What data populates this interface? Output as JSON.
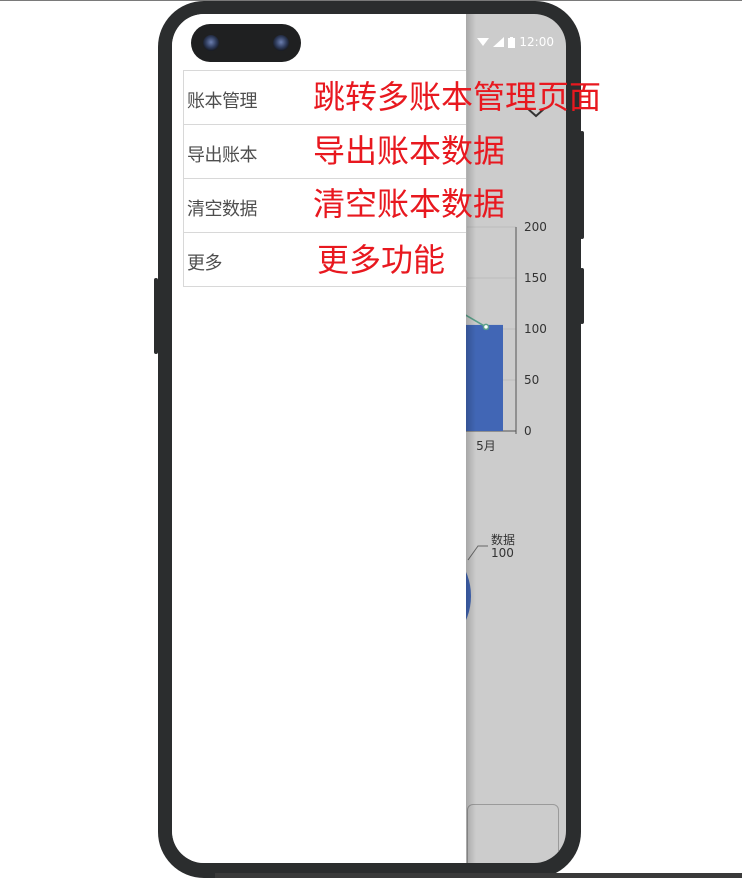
{
  "status_bar": {
    "time": "12:00"
  },
  "menu": {
    "items": [
      {
        "label": "账本管理"
      },
      {
        "label": "导出账本"
      },
      {
        "label": "清空数据"
      },
      {
        "label": "更多"
      }
    ]
  },
  "annotations": [
    "跳转多账本管理页面",
    "导出账本数据",
    "清空账本数据",
    "更多功能"
  ],
  "colors": {
    "annotation": "#e8181f",
    "bar": "#4166b5",
    "line": "#5aa08a",
    "overlay": "#cccccc"
  },
  "chart_data": [
    {
      "type": "bar",
      "categories": [
        "5月"
      ],
      "values": [
        104
      ],
      "ylim": [
        0,
        200
      ],
      "yticks": [
        0,
        50,
        100,
        150,
        200
      ],
      "grid": true
    },
    {
      "type": "pie",
      "slices": [
        {
          "label": "数据",
          "value": 100
        }
      ]
    }
  ]
}
